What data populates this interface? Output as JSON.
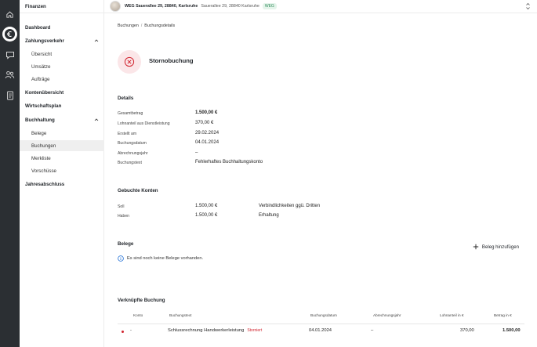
{
  "rail": {
    "icons": [
      "home-icon",
      "euro-icon",
      "chat-icon",
      "people-icon",
      "document-icon"
    ],
    "active": "euro-icon"
  },
  "sidebar": {
    "title": "Finanzen",
    "items": [
      {
        "label": "Dashboard",
        "type": "top"
      },
      {
        "label": "Zahlungsverkehr",
        "type": "top",
        "expanded": true
      },
      {
        "label": "Übersicht",
        "type": "sub"
      },
      {
        "label": "Umsätze",
        "type": "sub"
      },
      {
        "label": "Aufträge",
        "type": "sub"
      },
      {
        "label": "Kontenübersicht",
        "type": "top"
      },
      {
        "label": "Wirtschaftsplan",
        "type": "top"
      },
      {
        "label": "Buchhaltung",
        "type": "top",
        "expanded": true
      },
      {
        "label": "Belege",
        "type": "sub"
      },
      {
        "label": "Buchungen",
        "type": "sub",
        "active": true
      },
      {
        "label": "Merkliste",
        "type": "sub"
      },
      {
        "label": "Vorschüsse",
        "type": "sub"
      },
      {
        "label": "Jahresabschluss",
        "type": "top"
      }
    ]
  },
  "topbar": {
    "property_name": "WEG Sauerallee 29, 28840, Karlsruhe",
    "property_address": "Sauerallee 29, 28840 Karlsruhe",
    "badge": "WEG"
  },
  "breadcrumb": {
    "parent": "Buchungen",
    "separator": "/",
    "current": "Buchungsdetails"
  },
  "status": {
    "title": "Stornobuchung",
    "color": "#d1242f"
  },
  "details": {
    "heading": "Details",
    "rows": [
      {
        "label": "Gesamtbetrag",
        "value": "1.500,00 €",
        "bold": true
      },
      {
        "label": "Lohnanteil aus Dienstleistung",
        "value": "370,00 €"
      },
      {
        "label": "Erstellt am",
        "value": "29.02.2024"
      },
      {
        "label": "Buchungsdatum",
        "value": "04.01.2024"
      },
      {
        "label": "Abrechnungsjahr",
        "value": "–"
      },
      {
        "label": "Buchungstext",
        "value": "Fehlerhaftes Buchhaltungskonto"
      }
    ]
  },
  "accounts": {
    "heading": "Gebuchte Konten",
    "rows": [
      {
        "label": "Soll",
        "amount": "1.500,00 €",
        "account": "Verbindlichkeiten ggü. Dritten"
      },
      {
        "label": "Haben",
        "amount": "1.500,00 €",
        "account": "Erhaltung"
      }
    ]
  },
  "belege": {
    "heading": "Belege",
    "add_label": "Beleg hinzufügen",
    "empty_text": "Es sind noch keine Belege vorhanden."
  },
  "linked": {
    "heading": "Verknüpfte Buchung",
    "columns": [
      "Konto",
      "Buchungstext",
      "Buchungsdatum",
      "Abrechnungsjahr",
      "Lohnanteil in €",
      "Betrag in €"
    ],
    "rows": [
      {
        "konto": "-",
        "text": "Schlussrechnung Handwerkerleistung",
        "status": "Storniert",
        "date": "04.01.2024",
        "year": "–",
        "lohn": "370,00",
        "betrag": "1.500,00"
      }
    ]
  }
}
